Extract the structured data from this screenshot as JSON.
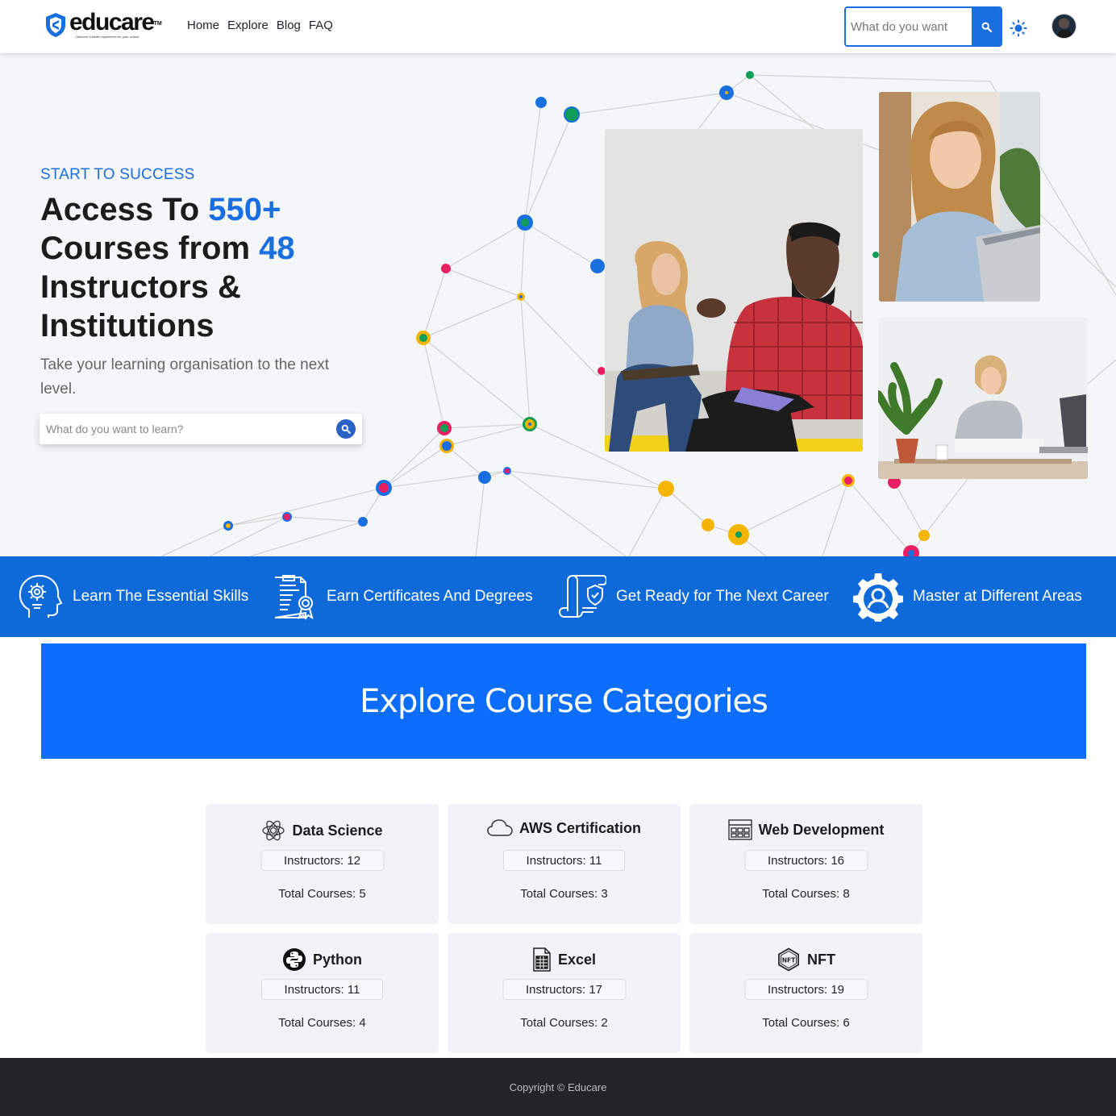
{
  "navbar": {
    "brand": "educare",
    "brand_mark": "TM",
    "tagline": "Discover a better experience for your school",
    "links": [
      "Home",
      "Explore",
      "Blog",
      "FAQ"
    ],
    "search_placeholder": "What do you want",
    "icons": [
      "shield-logo-icon",
      "search-icon",
      "sun-icon",
      "user-avatar"
    ]
  },
  "hero": {
    "eyebrow": "START TO SUCCESS",
    "title_part1": "Access To ",
    "title_hl1": "550+",
    "title_part2": " Courses from ",
    "title_hl2": "48",
    "title_part3": " Instructors & Institutions",
    "subtitle": "Take your learning organisation to the next level.",
    "search_placeholder": "What do you want to learn?"
  },
  "features": [
    {
      "icon": "head-gear-icon",
      "label": "Learn The Essential Skills"
    },
    {
      "icon": "certificate-icon",
      "label": "Earn Certificates And Degrees"
    },
    {
      "icon": "scroll-shield-icon",
      "label": "Get Ready for The Next Career"
    },
    {
      "icon": "gear-user-icon",
      "label": "Master at Different Areas"
    }
  ],
  "categories": {
    "heading": "Explore Course Categories",
    "items": [
      {
        "name": "Data Science",
        "icon": "atom-icon",
        "instructors": "Instructors: 12",
        "courses": "Total Courses: 5"
      },
      {
        "name": "AWS Certification",
        "icon": "cloud-icon",
        "instructors": "Instructors: 11",
        "courses": "Total Courses: 3"
      },
      {
        "name": "Web Development",
        "icon": "browser-window-icon",
        "instructors": "Instructors: 16",
        "courses": "Total Courses: 8"
      },
      {
        "name": "Python",
        "icon": "python-icon",
        "instructors": "Instructors: 11",
        "courses": "Total Courses: 4"
      },
      {
        "name": "Excel",
        "icon": "spreadsheet-icon",
        "instructors": "Instructors: 17",
        "courses": "Total Courses: 2"
      },
      {
        "name": "NFT",
        "icon": "nft-hexagon-icon",
        "instructors": "Instructors: 19",
        "courses": "Total Courses: 6"
      }
    ]
  },
  "footer": {
    "copyright": "Copyright © Educare"
  },
  "colors": {
    "primary": "#0d6efd",
    "strip": "#0d6ad8",
    "footer": "#212529",
    "accent_text": "#1a6fe0"
  }
}
